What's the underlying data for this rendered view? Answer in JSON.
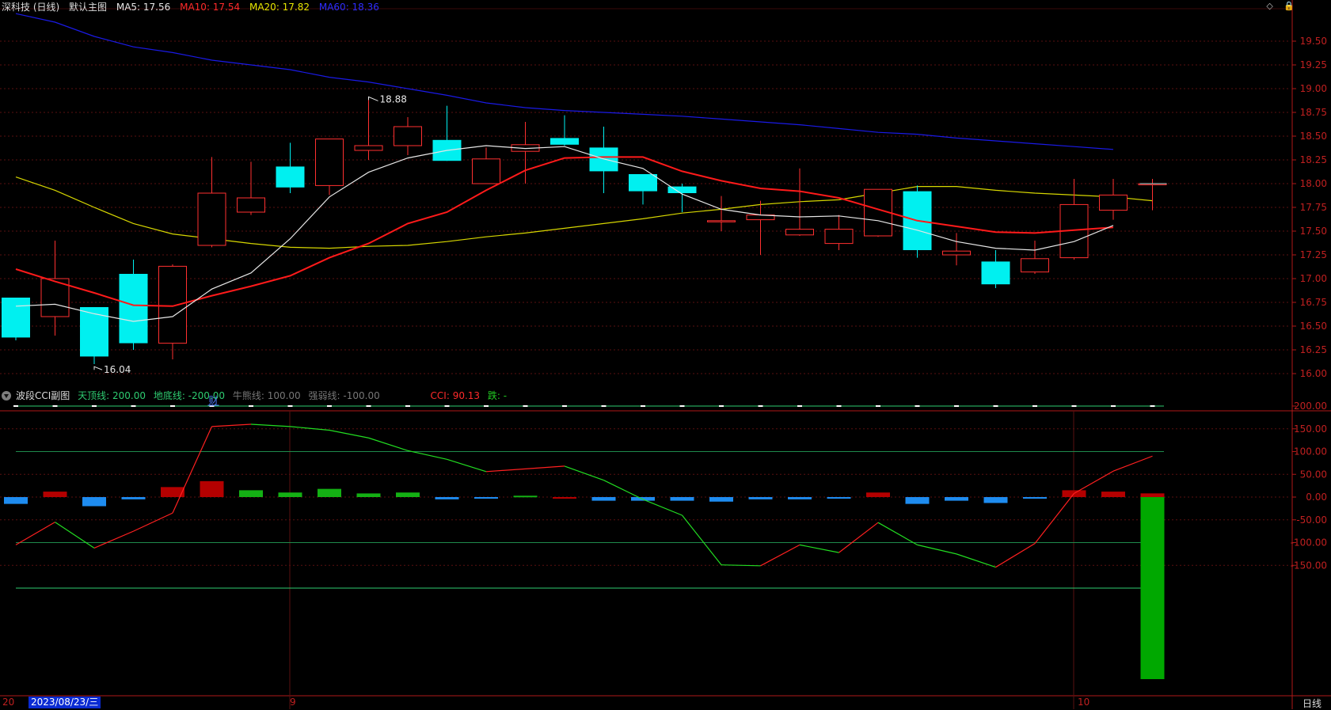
{
  "header": {
    "stock": "深科技 (日线)",
    "template": "默认主图",
    "ma": [
      {
        "label": "MA5: 17.56",
        "color": "#e6e6e6"
      },
      {
        "label": "MA10: 17.54",
        "color": "#ff2a2a"
      },
      {
        "label": "MA20: 17.82",
        "color": "#e6e600"
      },
      {
        "label": "MA60: 18.36",
        "color": "#2d2dff"
      }
    ]
  },
  "sub_header": {
    "title": "波段CCI副图",
    "items": [
      {
        "label": "天顶线: 200.00",
        "color": "#2ecc71"
      },
      {
        "label": "地底线: -200.00",
        "color": "#2ecc71"
      },
      {
        "label": "牛熊线: 100.00",
        "color": "#777777"
      },
      {
        "label": "强弱线: -100.00",
        "color": "#777777"
      },
      {
        "label": "CCI: 90.13",
        "color": "#ff2a2a"
      },
      {
        "label": "跌: -",
        "color": "#22cc22"
      }
    ]
  },
  "top_icons": {
    "diamond": "◇",
    "lock": "🔒"
  },
  "annotations": {
    "high": "18.88",
    "low": "16.04",
    "marker": "财"
  },
  "xaxis": {
    "date_box": "2023/08/23/三",
    "left_clip": "20",
    "month_9": "9",
    "month_10": "10",
    "freq": "日线"
  },
  "chart_data": [
    {
      "type": "candlestick",
      "title": "深科技 (日线)",
      "ylim": [
        15.9,
        19.7
      ],
      "yticks": [
        "19.50",
        "19.25",
        "19.00",
        "18.75",
        "18.50",
        "18.25",
        "18.00",
        "17.75",
        "17.50",
        "17.25",
        "17.00",
        "16.75",
        "16.50",
        "16.25",
        "16.00"
      ],
      "ohlc": [
        [
          16.8,
          16.8,
          16.35,
          16.38
        ],
        [
          16.6,
          17.4,
          16.4,
          17.0
        ],
        [
          16.7,
          16.7,
          16.1,
          16.18
        ],
        [
          17.05,
          17.2,
          16.25,
          16.32
        ],
        [
          16.32,
          17.15,
          16.15,
          17.13
        ],
        [
          17.35,
          18.28,
          17.33,
          17.9
        ],
        [
          17.7,
          18.23,
          17.67,
          17.85
        ],
        [
          18.18,
          18.43,
          17.9,
          17.96
        ],
        [
          17.98,
          18.47,
          17.88,
          18.47
        ],
        [
          18.35,
          18.88,
          18.25,
          18.4
        ],
        [
          18.4,
          18.7,
          18.3,
          18.6
        ],
        [
          18.46,
          18.82,
          18.24,
          18.24
        ],
        [
          18.0,
          18.38,
          18.0,
          18.26
        ],
        [
          18.34,
          18.65,
          18.0,
          18.41
        ],
        [
          18.48,
          18.72,
          18.4,
          18.41
        ],
        [
          18.38,
          18.6,
          17.9,
          18.13
        ],
        [
          18.1,
          18.1,
          17.78,
          17.92
        ],
        [
          17.97,
          18.0,
          17.7,
          17.9
        ],
        [
          17.6,
          17.87,
          17.5,
          17.61
        ],
        [
          17.62,
          17.82,
          17.25,
          17.67
        ],
        [
          17.46,
          18.16,
          17.45,
          17.52
        ],
        [
          17.37,
          17.67,
          17.3,
          17.52
        ],
        [
          17.45,
          17.94,
          17.44,
          17.94
        ],
        [
          17.92,
          17.98,
          17.22,
          17.3
        ],
        [
          17.25,
          17.48,
          17.14,
          17.29
        ],
        [
          17.18,
          17.3,
          16.9,
          16.94
        ],
        [
          17.07,
          17.4,
          17.05,
          17.21
        ],
        [
          17.22,
          18.05,
          17.2,
          17.78
        ],
        [
          17.72,
          18.05,
          17.62,
          17.88
        ],
        [
          18.0,
          18.05,
          17.72,
          18.0
        ]
      ],
      "ma5": [
        16.71,
        16.73,
        16.63,
        16.55,
        16.6,
        16.89,
        17.06,
        17.42,
        17.86,
        18.12,
        18.27,
        18.35,
        18.4,
        18.37,
        18.39,
        18.26,
        18.16,
        17.89,
        17.73,
        17.67,
        17.65,
        17.66,
        17.61,
        17.51,
        17.39,
        17.32,
        17.3,
        17.39,
        17.56
      ],
      "ma10": [
        17.1,
        16.97,
        16.85,
        16.72,
        16.71,
        16.82,
        16.92,
        17.03,
        17.22,
        17.37,
        17.58,
        17.7,
        17.93,
        18.14,
        18.27,
        18.28,
        18.28,
        18.13,
        18.03,
        17.95,
        17.92,
        17.85,
        17.73,
        17.61,
        17.55,
        17.49,
        17.48,
        17.51,
        17.54
      ],
      "ma20": [
        18.07,
        17.93,
        17.75,
        17.58,
        17.47,
        17.42,
        17.37,
        17.33,
        17.32,
        17.34,
        17.35,
        17.39,
        17.44,
        17.48,
        17.53,
        17.58,
        17.63,
        17.69,
        17.73,
        17.78,
        17.81,
        17.83,
        17.9,
        17.97,
        17.97,
        17.93,
        17.9,
        17.88,
        17.86,
        17.82
      ],
      "ma60": [
        19.79,
        19.7,
        19.55,
        19.44,
        19.38,
        19.3,
        19.25,
        19.2,
        19.12,
        19.07,
        19.0,
        18.93,
        18.85,
        18.8,
        18.77,
        18.75,
        18.73,
        18.71,
        18.68,
        18.65,
        18.62,
        18.58,
        18.54,
        18.52,
        18.48,
        18.45,
        18.42,
        18.39,
        18.36
      ]
    },
    {
      "type": "line",
      "title": "波段CCI副图",
      "ylim": [
        -430,
        210
      ],
      "yticks": [
        "200.00",
        "150.00",
        "100.00",
        "50.00",
        "0.00",
        "-50.00",
        "-100.00",
        "-150.00"
      ],
      "levels": [
        200,
        100,
        -100,
        -200
      ],
      "cci": [
        -105,
        -55,
        -112,
        -75,
        -35,
        155,
        160,
        155,
        147,
        130,
        102,
        83,
        56,
        62,
        68,
        37,
        -5,
        -40,
        -149,
        -151,
        -105,
        -122,
        -56,
        -105,
        -125,
        -154,
        -102,
        8,
        57,
        90
      ],
      "histogram": [
        -15,
        12,
        -20,
        -5,
        22,
        35,
        15,
        10,
        18,
        8,
        10,
        -5,
        -3,
        3,
        -2,
        -8,
        -8,
        -8,
        -10,
        -5,
        -5,
        -3,
        10,
        -15,
        -8,
        -13,
        -2,
        15,
        12,
        8,
        -428
      ]
    }
  ]
}
